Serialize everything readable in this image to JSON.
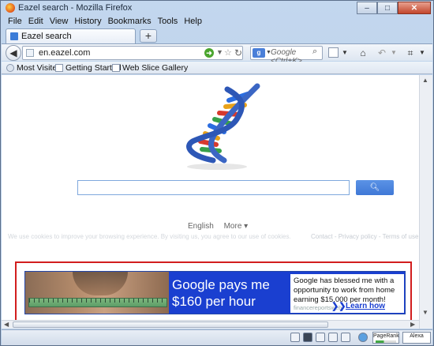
{
  "window": {
    "title": "Eazel search - Mozilla Firefox",
    "minimize_label": "‒",
    "maximize_label": "□",
    "close_label": "✕"
  },
  "menu": [
    "File",
    "Edit",
    "View",
    "History",
    "Bookmarks",
    "Tools",
    "Help"
  ],
  "tab": {
    "label": "Eazel search",
    "new_tab_label": "+"
  },
  "navbar": {
    "url": "en.eazel.com",
    "search_placeholder": "Google <Ctrl+K>",
    "search_engine_icon": "google-icon"
  },
  "bookmarks": [
    "Most Visited",
    "Getting Started",
    "Web Slice Gallery"
  ],
  "page": {
    "search_value": "",
    "search_button_icon": "magnifier-icon",
    "language": "English",
    "more_label": "More ▾",
    "cookie_notice": "We use cookies to improve your browsing experience. By visiting us, you agree to our use of cookies.",
    "footer_links": [
      "Contact",
      "Privacy policy",
      "Terms of use"
    ],
    "ad": {
      "headline": "Google pays me $160 per hour",
      "body": "Google has blessed me with a opportunity to work from home earning $15,000 per month!",
      "source": "financereportsweb",
      "cta": "Learn how",
      "cta_arrows": "❯❯"
    }
  },
  "addons": {
    "pagerank_label": "PageRank",
    "alexa_label": "Alexa"
  },
  "colors": {
    "ad_border": "#d21e1e",
    "ad_blue": "#1a3fd0",
    "search_button": "#4a84dd"
  }
}
